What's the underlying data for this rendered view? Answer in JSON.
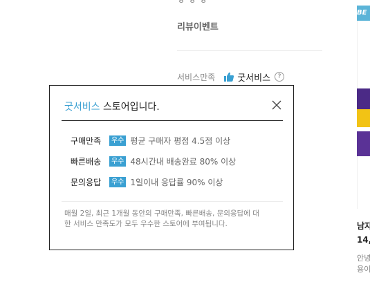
{
  "review_event": "리뷰이벤트",
  "service": {
    "label": "서비스만족",
    "value": "굿서비스",
    "help": "?"
  },
  "right_product": {
    "badge": "BE",
    "title": "남자",
    "price": "14,",
    "desc_line1": "안녕",
    "desc_line2": "용이"
  },
  "popup": {
    "title_accent": "굿서비스",
    "title_rest": " 스토어입니다.",
    "criteria": [
      {
        "name": "구매만족",
        "badge": "우수",
        "desc": "평균 구매자 평점 4.5점 이상"
      },
      {
        "name": "빠른배송",
        "badge": "우수",
        "desc": "48시간내 배송완료 80% 이상"
      },
      {
        "name": "문의응답",
        "badge": "우수",
        "desc": "1일이내 응답률 90% 이상"
      }
    ],
    "note": "매월 2일, 최근 1개월 동안의 구매만족, 빠른배송, 문의응답에 대한 서비스 만족도가 모두 우수한 스토어에 부여됩니다."
  },
  "colors": {
    "accent": "#3aa0d2",
    "badge_bg": "#5bb4d8"
  }
}
